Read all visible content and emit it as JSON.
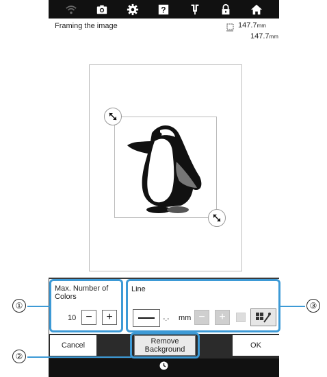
{
  "toolbar": {
    "icons": [
      "wifi-icon",
      "camera-icon",
      "settings-icon",
      "help-icon",
      "needle-icon",
      "lock-icon",
      "home-icon"
    ]
  },
  "header": {
    "title": "Framing the image",
    "width_value": "147.7",
    "height_value": "147.7",
    "unit": "mm"
  },
  "max_colors": {
    "label": "Max. Number of Colors",
    "value": "10",
    "minus": "−",
    "plus": "+"
  },
  "line": {
    "label": "Line",
    "thickness_value": "-.-",
    "unit": "mm",
    "minus": "−",
    "plus": "+"
  },
  "actions": {
    "cancel": "Cancel",
    "remove_background": "Remove Background",
    "ok": "OK"
  },
  "callouts": [
    "①",
    "②",
    "③"
  ],
  "colors": {
    "accent": "#3d9ad6",
    "toolbar_bg": "#111111",
    "panel_bg": "#2b2b2b"
  }
}
